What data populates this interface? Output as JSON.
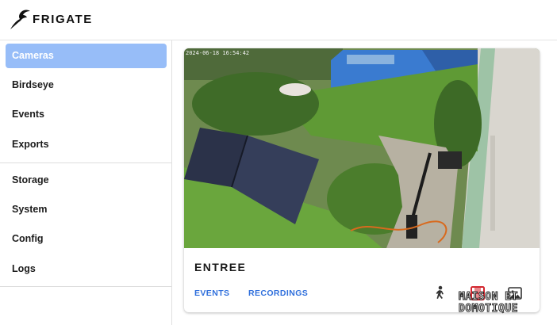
{
  "app": {
    "brand": "FRIGATE"
  },
  "sidebar": {
    "items": [
      {
        "label": "Cameras",
        "active": true
      },
      {
        "label": "Birdseye",
        "active": false
      },
      {
        "label": "Events",
        "active": false
      },
      {
        "label": "Exports",
        "active": false
      },
      {
        "label": "Storage",
        "active": false
      },
      {
        "label": "System",
        "active": false
      },
      {
        "label": "Config",
        "active": false
      },
      {
        "label": "Logs",
        "active": false
      }
    ]
  },
  "camera_card": {
    "name": "ENTREE",
    "timestamp": "2024-06-18 16:54:42",
    "links": {
      "events": "EVENTS",
      "recordings": "RECORDINGS"
    },
    "icons": [
      "person-icon",
      "film-icon",
      "image-icon"
    ]
  },
  "watermark": {
    "line1": "MAISON ET",
    "line2": "DOMOTIQUE"
  },
  "colors": {
    "accent": "#97bdf8",
    "link": "#2f6fdc"
  }
}
